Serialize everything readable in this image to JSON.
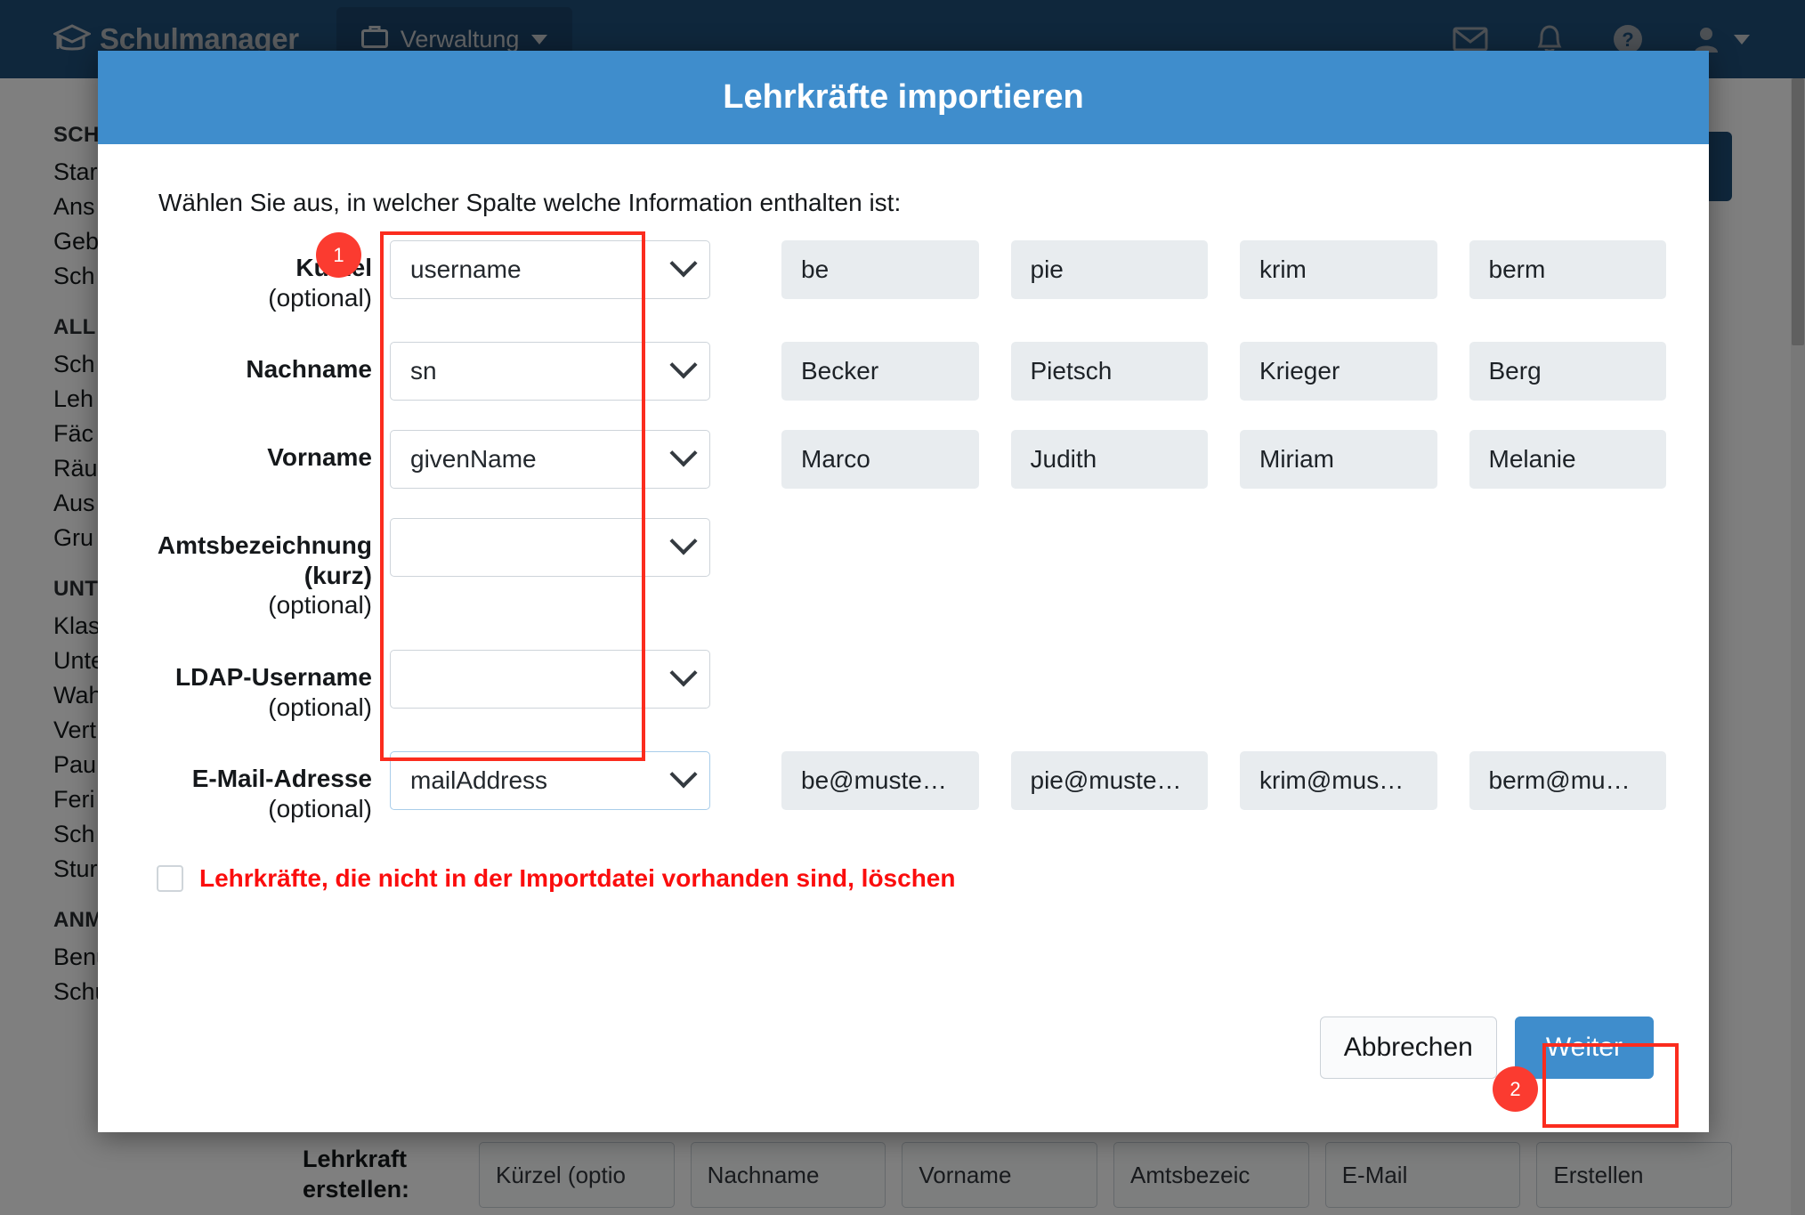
{
  "navbar": {
    "brand": "Schulmanager",
    "brand_icon": "graduation-cap-icon",
    "module_button": "Verwaltung",
    "icons": [
      {
        "name": "mail-icon"
      },
      {
        "name": "bell-icon"
      },
      {
        "name": "help-icon"
      },
      {
        "name": "user-icon"
      }
    ]
  },
  "sidebar": {
    "groups": [
      {
        "heading": "SCH",
        "items": [
          "Star",
          "Ans",
          "Geb",
          "Sch"
        ]
      },
      {
        "heading": "ALL",
        "items": [
          "Sch",
          "Leh",
          "Fäc",
          "Räu",
          "Aus",
          "Gru"
        ]
      },
      {
        "heading": "UNT",
        "items": [
          "Klas",
          "Unte",
          "Wah",
          "Vert",
          "Pau",
          "Feri",
          "Sch",
          "Stur"
        ]
      },
      {
        "heading": "ANM",
        "items": [
          "Benutzer",
          "Schüler/Eltern"
        ]
      }
    ]
  },
  "create_row": {
    "label": "Lehrkraft erstellen:",
    "fields": [
      "Kürzel (optio",
      "Nachname",
      "Vorname",
      "Amtsbezeic",
      "E-Mail",
      "Erstellen"
    ]
  },
  "modal": {
    "title": "Lehrkräfte importieren",
    "intro": "Wählen Sie aus, in welcher Spalte welche Information enthalten ist:",
    "rows": [
      {
        "label": "Kürzel",
        "optional": "(optional)",
        "select_value": "username",
        "focused": false,
        "preview": [
          "be",
          "pie",
          "krim",
          "berm"
        ]
      },
      {
        "label": "Nachname",
        "optional": "",
        "select_value": "sn",
        "focused": false,
        "preview": [
          "Becker",
          "Pietsch",
          "Krieger",
          "Berg"
        ]
      },
      {
        "label": "Vorname",
        "optional": "",
        "select_value": "givenName",
        "focused": false,
        "preview": [
          "Marco",
          "Judith",
          "Miriam",
          "Melanie"
        ]
      },
      {
        "label": "Amtsbezeichnung (kurz)",
        "optional": "(optional)",
        "select_value": "",
        "focused": false,
        "preview": [
          "",
          "",
          "",
          ""
        ]
      },
      {
        "label": "LDAP-Username",
        "optional": "(optional)",
        "select_value": "",
        "focused": false,
        "preview": [
          "",
          "",
          "",
          ""
        ]
      },
      {
        "label": "E-Mail-Adresse",
        "optional": "(optional)",
        "select_value": "mailAddress",
        "focused": true,
        "preview": [
          "be@muste…",
          "pie@muste…",
          "krim@mus…",
          "berm@mu…"
        ]
      }
    ],
    "delete_checkbox": {
      "checked": false,
      "label": "Lehrkräfte, die nicht in der Importdatei vorhanden sind, löschen"
    },
    "footer": {
      "cancel_label": "Abbrechen",
      "next_label": "Weiter"
    }
  },
  "annotations": [
    {
      "badge": "1",
      "target": "select-column"
    },
    {
      "badge": "2",
      "target": "next-button"
    }
  ],
  "colors": {
    "navbar": "#1f4e79",
    "modal_header": "#3f8dcc",
    "primary_button": "#3f8dcc",
    "annotation_red": "#fb2c1e",
    "badge_red": "#fb3b30",
    "danger_text": "#fb0d0d"
  }
}
